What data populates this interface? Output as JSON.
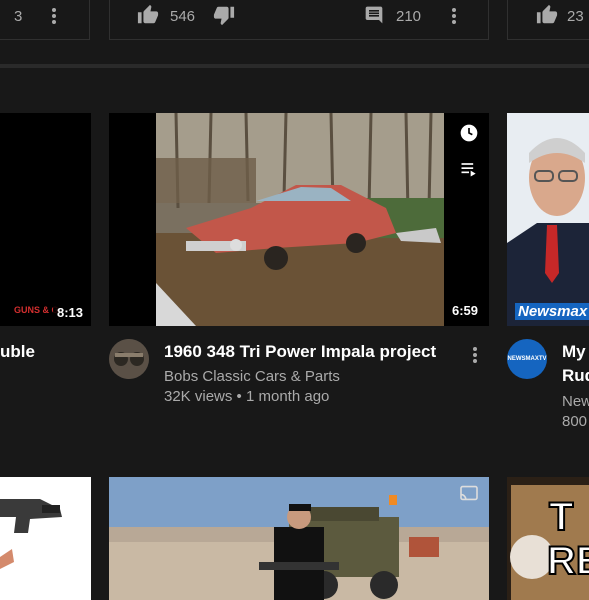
{
  "top_cards": [
    {
      "dislikes_count": "3"
    },
    {
      "likes": "546",
      "comments": "210"
    },
    {
      "likes": "23"
    }
  ],
  "videos": [
    {
      "partial_title": "uble",
      "duration": "8:13",
      "brand_mark": "GUNS & G"
    },
    {
      "title": "1960 348 Tri Power Impala project",
      "channel": "Bobs Classic Cars & Parts",
      "views": "32K views",
      "separator": "•",
      "age": "1 month ago",
      "duration": "6:59"
    },
    {
      "title_line1": "My",
      "title_line2": "Rud",
      "channel": "New",
      "views": "800",
      "avatar_text": "NEWSMAXTV",
      "thumb_brand": "Newsmax"
    }
  ],
  "bottom_thumb_text_line1": "T",
  "bottom_thumb_text_line2": "RE",
  "colors": {
    "background": "#181818",
    "text": "#ffffff",
    "secondary": "#aaaaaa",
    "newsmax_blue": "#1565c0"
  }
}
